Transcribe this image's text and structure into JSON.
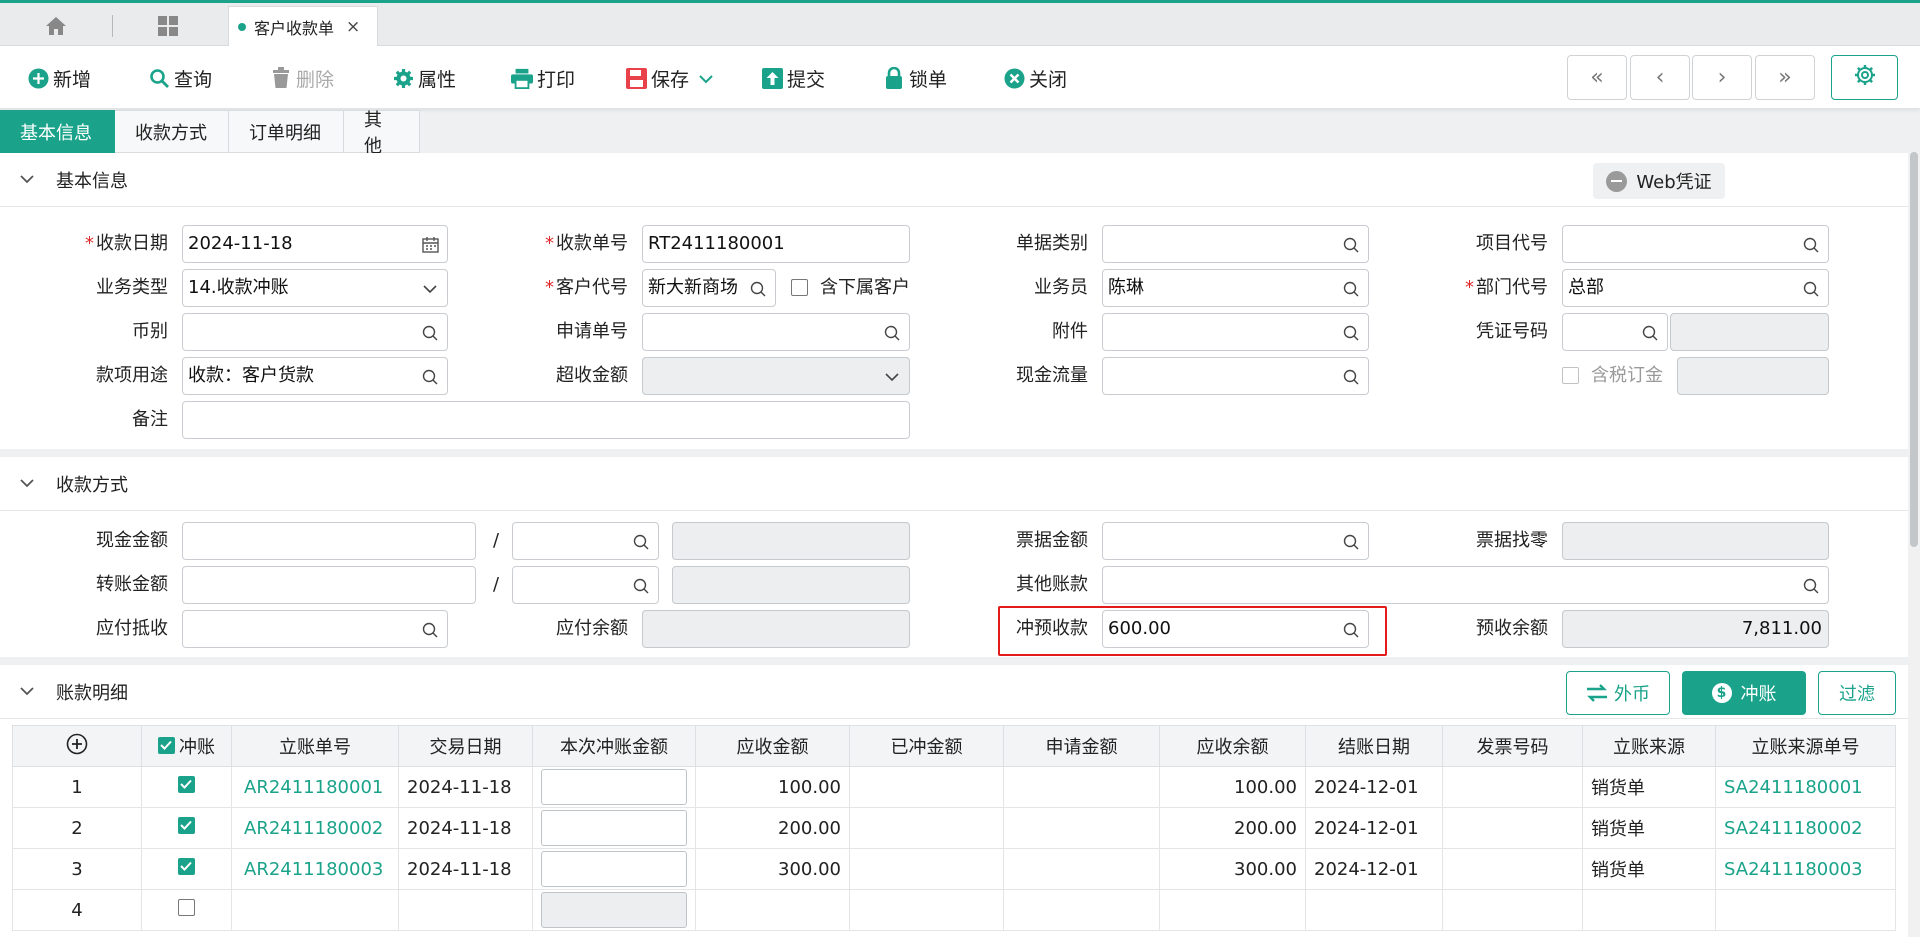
{
  "tabs": {
    "home_icon": "home-icon",
    "apps_icon": "grid-icon",
    "doc_tab": "客户收款单",
    "close": "×"
  },
  "toolbar": {
    "new": "新增",
    "query": "查询",
    "delete": "删除",
    "properties": "属性",
    "print": "打印",
    "save": "保存",
    "submit": "提交",
    "lock": "锁单",
    "close": "关闭",
    "nav_first": "«",
    "nav_prev": "‹",
    "nav_next": "›",
    "nav_last": "»"
  },
  "section_tabs": [
    "基本信息",
    "收款方式",
    "订单明细",
    "其他"
  ],
  "basic": {
    "title": "基本信息",
    "web_voucher": "Web凭证",
    "labels": {
      "receipt_date": "收款日期",
      "receipt_no": "收款单号",
      "doc_type": "单据类别",
      "project_code": "项目代号",
      "biz_type": "业务类型",
      "customer_code": "客户代号",
      "include_sub": "含下属客户",
      "salesperson": "业务员",
      "dept_code": "部门代号",
      "currency": "币别",
      "apply_no": "申请单号",
      "attachment": "附件",
      "voucher_no": "凭证号码",
      "purpose": "款项用途",
      "over_amount": "超收金额",
      "cash_flow": "现金流量",
      "tax_deposit": "含税订金",
      "remark": "备注"
    },
    "values": {
      "receipt_date": "2024-11-18",
      "receipt_no": "RT2411180001",
      "biz_type": "14.收款冲账",
      "customer_code": "新大新商场",
      "salesperson": "陈琳",
      "dept_code": "总部",
      "purpose": "收款：客户货款"
    }
  },
  "payment": {
    "title": "收款方式",
    "labels": {
      "cash": "现金金额",
      "transfer": "转账金额",
      "payable_offset": "应付抵收",
      "payable_balance": "应付余额",
      "bill_amount": "票据金额",
      "other_account": "其他账款",
      "prepay_offset": "冲预收款",
      "bill_change": "票据找零",
      "prepay_balance": "预收余额"
    },
    "slash": "/",
    "values": {
      "prepay_offset": "600.00",
      "prepay_balance": "7,811.00"
    }
  },
  "detail": {
    "title": "账款明细",
    "btn_currency": "外币",
    "btn_offset": "冲账",
    "btn_filter": "过滤",
    "columns": [
      "冲账",
      "立账单号",
      "交易日期",
      "本次冲账金额",
      "应收金额",
      "已冲金额",
      "申请金额",
      "应收余额",
      "结账日期",
      "发票号码",
      "立账来源",
      "立账来源单号"
    ],
    "rows": [
      {
        "no": "1",
        "doc": "AR2411180001",
        "date": "2024-11-18",
        "receivable": "100.00",
        "balance": "100.00",
        "close_date": "2024-12-01",
        "source": "销货单",
        "source_no": "SA2411180001",
        "checked": true
      },
      {
        "no": "2",
        "doc": "AR2411180002",
        "date": "2024-11-18",
        "receivable": "200.00",
        "balance": "200.00",
        "close_date": "2024-12-01",
        "source": "销货单",
        "source_no": "SA2411180002",
        "checked": true
      },
      {
        "no": "3",
        "doc": "AR2411180003",
        "date": "2024-11-18",
        "receivable": "300.00",
        "balance": "300.00",
        "close_date": "2024-12-01",
        "source": "销货单",
        "source_no": "SA2411180003",
        "checked": true
      },
      {
        "no": "4",
        "doc": "",
        "date": "",
        "receivable": "",
        "balance": "",
        "close_date": "",
        "source": "",
        "source_no": "",
        "checked": false
      }
    ]
  },
  "colors": {
    "accent": "#1aa38a",
    "required": "#e0282a",
    "highlight": "#e31b1b"
  }
}
